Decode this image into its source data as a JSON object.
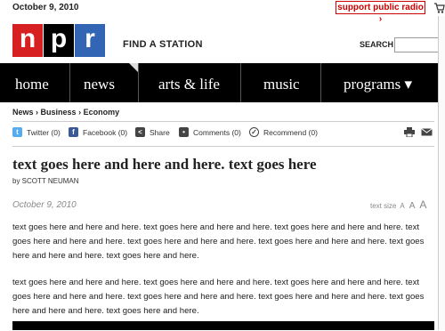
{
  "top_bar": {
    "date": "October 9, 2010",
    "support_label": "support public radio ›"
  },
  "header": {
    "logo_letters": [
      "n",
      "p",
      "r"
    ],
    "logo_colors": [
      "#d62021",
      "#000000",
      "#3266b4"
    ],
    "find_station": "FIND A STATION",
    "search_label": "SEARCH",
    "search_placeholder": ""
  },
  "nav": {
    "items": [
      "home",
      "news",
      "arts & life",
      "music",
      "programs ▾"
    ]
  },
  "breadcrumb": [
    "News",
    "Business",
    "Economy"
  ],
  "breadcrumb_sep": "›",
  "share": {
    "items": [
      {
        "label": "Twitter (0)",
        "icon": "twitter-icon"
      },
      {
        "label": "Facebook (0)",
        "icon": "facebook-icon"
      },
      {
        "label": "Share",
        "icon": "share-icon"
      },
      {
        "label": "Comments (0)",
        "icon": "comments-icon"
      },
      {
        "label": "Recommend (0)",
        "icon": "recommend-icon"
      }
    ],
    "right_icons": [
      "print-icon",
      "email-icon"
    ]
  },
  "article": {
    "headline": "text goes here and here and here. text goes here",
    "byline": "by SCOTT NEUMAN",
    "date": "October 9, 2010",
    "text_size_label": "text size",
    "text_size_options": [
      "A",
      "A",
      "A"
    ],
    "paragraphs": [
      "text goes here and here and here. text goes here and here and here. text goes here and here and here. text goes here and here and here. text goes here and here and here. text goes here and here and here. text goes here and here and here. text goes here and here.",
      "text goes here and here and here. text goes here and here and here. text goes here and here and here. text goes here and here and here. text goes here and here and here. text goes here and here and here. text goes here and here and here. text goes here and here."
    ]
  }
}
